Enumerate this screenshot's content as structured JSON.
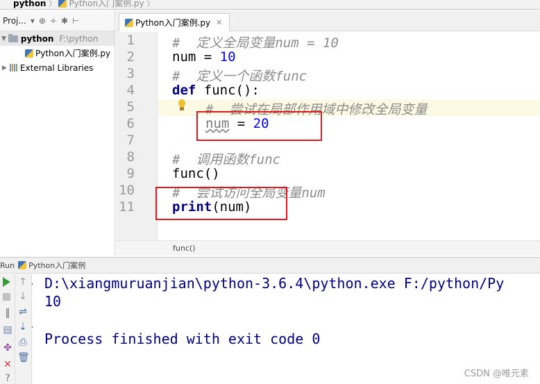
{
  "breadcrumb": {
    "project": "python",
    "file": "Python入门案例.py"
  },
  "project_panel": {
    "header_label": "Proj...",
    "root_name": "python",
    "root_path": "F:\\python",
    "file_name": "Python入门案例.py",
    "external_libraries": "External Libraries"
  },
  "editor": {
    "tab_label": "Python入门案例.py",
    "line_numbers": [
      "1",
      "2",
      "3",
      "4",
      "5",
      "6",
      "7",
      "8",
      "9",
      "10",
      "11"
    ],
    "lines": {
      "l1": "#  定义全局变量num = 10",
      "l2_var": "num",
      "l2_op": " = ",
      "l2_val": "10",
      "l3": "#  定义一个函数func",
      "l4_kw": "def",
      "l4_rest": " func():",
      "l5": "#  尝试在局部作用域中修改全局变量",
      "l6_var": "num",
      "l6_op": " = ",
      "l6_val": "20",
      "l8": "#  调用函数func",
      "l9": "func()",
      "l10": "#  尝试访问全局变量num",
      "l11_kw": "print",
      "l11_rest": "(num)"
    },
    "status_context": "func()"
  },
  "run_panel": {
    "label": "Run",
    "config": "Python入门案例",
    "console_lines": [
      "D:\\xiangmuruanjian\\python-3.6.4\\python.exe F:/python/Py",
      "10",
      "",
      "Process finished with exit code 0"
    ]
  },
  "watermark": "CSDN @唯元素",
  "colors": {
    "annotation": "#e0191f",
    "keyword": "#000080",
    "number": "#0000ff",
    "comment": "#8c8c8c"
  }
}
